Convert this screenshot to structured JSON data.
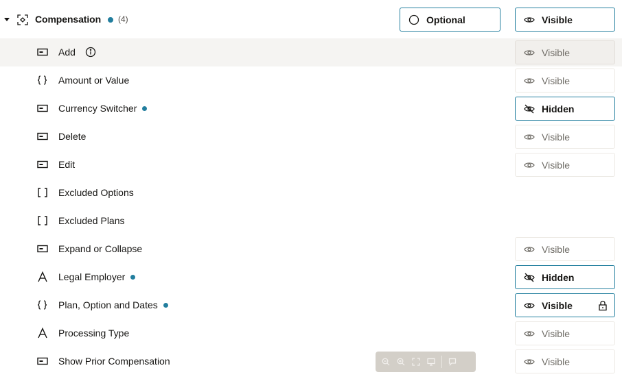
{
  "header": {
    "title": "Compensation",
    "count": "(4)",
    "optional_label": "Optional",
    "visible_label": "Visible"
  },
  "rows": [
    {
      "label": "Add",
      "icon": "button-icon",
      "state": "Visible",
      "dot": false
    },
    {
      "label": "Amount or Value",
      "icon": "braces-icon",
      "state": "Visible",
      "dot": false
    },
    {
      "label": "Currency Switcher",
      "icon": "button-icon",
      "state": "Hidden",
      "dot": true
    },
    {
      "label": "Delete",
      "icon": "button-icon",
      "state": "Visible",
      "dot": false
    },
    {
      "label": "Edit",
      "icon": "button-icon",
      "state": "Visible",
      "dot": false
    },
    {
      "label": "Excluded Options",
      "icon": "brackets-icon",
      "state": "",
      "dot": false
    },
    {
      "label": "Excluded Plans",
      "icon": "brackets-icon",
      "state": "",
      "dot": false
    },
    {
      "label": "Expand or Collapse",
      "icon": "button-icon",
      "state": "Visible",
      "dot": false
    },
    {
      "label": "Legal Employer",
      "icon": "text-a-icon",
      "state": "Hidden",
      "dot": true
    },
    {
      "label": "Plan, Option and Dates",
      "icon": "braces-icon",
      "state": "Visible",
      "dot": true
    },
    {
      "label": "Processing Type",
      "icon": "text-a-icon",
      "state": "Visible",
      "dot": false
    },
    {
      "label": "Show Prior Compensation",
      "icon": "button-icon",
      "state": "Visible",
      "dot": false
    }
  ],
  "colors": {
    "accent": "#227e9e",
    "row_highlight": "#f5f4f2",
    "toolbar_bg": "#cfcac3"
  },
  "toolbar": {
    "buttons": [
      "zoom-out-icon",
      "zoom-in-icon",
      "fit-icon",
      "preview-icon",
      "comment-icon"
    ]
  }
}
